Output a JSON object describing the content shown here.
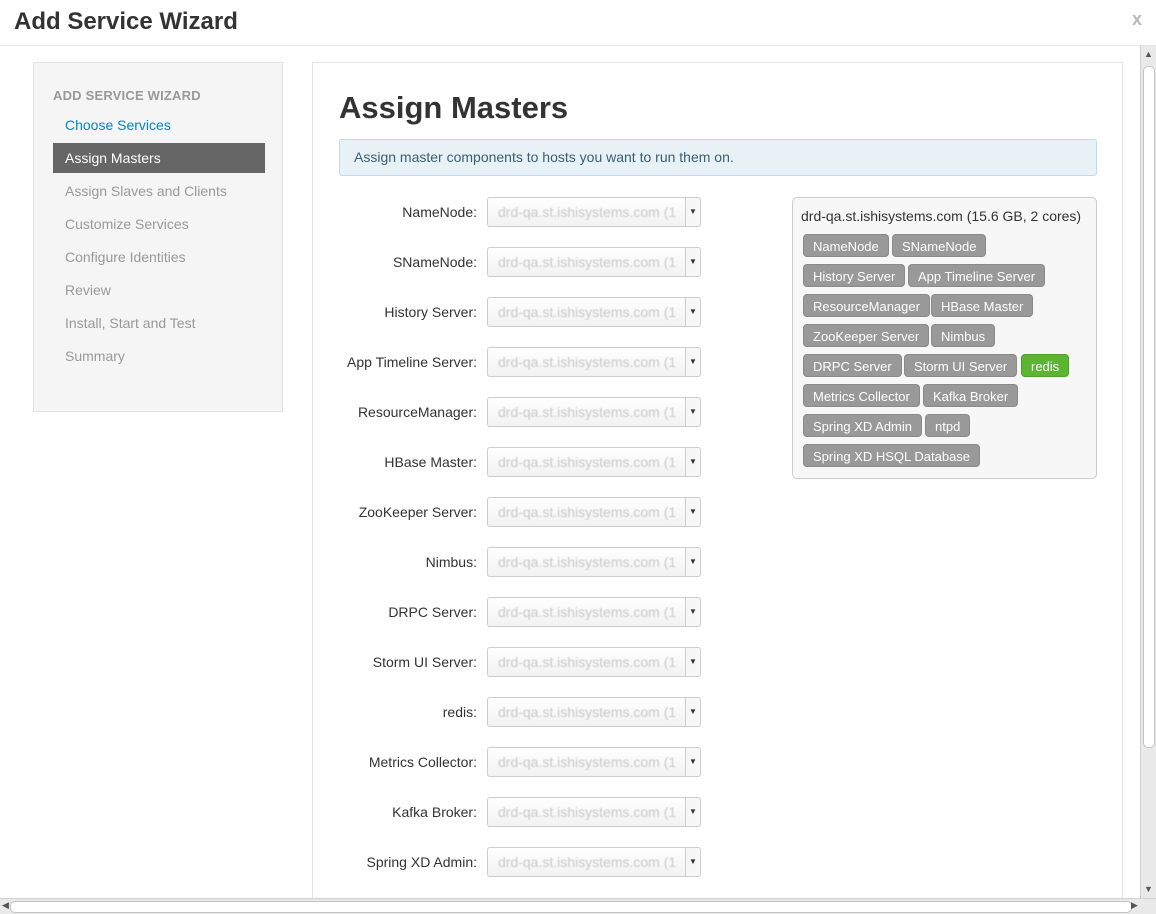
{
  "window": {
    "title": "Add Service Wizard",
    "close": "x"
  },
  "nav": {
    "header": "ADD SERVICE WIZARD",
    "items": [
      {
        "label": "Choose Services"
      },
      {
        "label": "Assign Masters"
      },
      {
        "label": "Assign Slaves and Clients"
      },
      {
        "label": "Customize Services"
      },
      {
        "label": "Configure Identities"
      },
      {
        "label": "Review"
      },
      {
        "label": "Install, Start and Test"
      },
      {
        "label": "Summary"
      }
    ]
  },
  "main": {
    "title": "Assign Masters",
    "info": "Assign master components to hosts you want to run them on.",
    "rows": [
      {
        "label": "NameNode:",
        "value": "drd-qa.st.ishisystems.com (1"
      },
      {
        "label": "SNameNode:",
        "value": "drd-qa.st.ishisystems.com (1"
      },
      {
        "label": "History Server:",
        "value": "drd-qa.st.ishisystems.com (1"
      },
      {
        "label": "App Timeline Server:",
        "value": "drd-qa.st.ishisystems.com (1"
      },
      {
        "label": "ResourceManager:",
        "value": "drd-qa.st.ishisystems.com (1"
      },
      {
        "label": "HBase Master:",
        "value": "drd-qa.st.ishisystems.com (1"
      },
      {
        "label": "ZooKeeper Server:",
        "value": "drd-qa.st.ishisystems.com (1"
      },
      {
        "label": "Nimbus:",
        "value": "drd-qa.st.ishisystems.com (1"
      },
      {
        "label": "DRPC Server:",
        "value": "drd-qa.st.ishisystems.com (1"
      },
      {
        "label": "Storm UI Server:",
        "value": "drd-qa.st.ishisystems.com (1"
      },
      {
        "label": "redis:",
        "value": "drd-qa.st.ishisystems.com (1"
      },
      {
        "label": "Metrics Collector:",
        "value": "drd-qa.st.ishisystems.com (1"
      },
      {
        "label": "Kafka Broker:",
        "value": "drd-qa.st.ishisystems.com (1"
      },
      {
        "label": "Spring XD Admin:",
        "value": "drd-qa.st.ishisystems.com (1"
      }
    ],
    "host": {
      "title": "drd-qa.st.ishisystems.com (15.6 GB, 2 cores)",
      "components": [
        {
          "label": "NameNode"
        },
        {
          "label": "SNameNode"
        },
        {
          "label": "History Server"
        },
        {
          "label": "App Timeline Server"
        },
        {
          "label": "ResourceManager"
        },
        {
          "label": "HBase Master"
        },
        {
          "label": "ZooKeeper Server"
        },
        {
          "label": "Nimbus"
        },
        {
          "label": "DRPC Server"
        },
        {
          "label": "Storm UI Server"
        },
        {
          "label": "redis"
        },
        {
          "label": "Metrics Collector"
        },
        {
          "label": "Kafka Broker"
        },
        {
          "label": "Spring XD Admin"
        },
        {
          "label": "ntpd"
        },
        {
          "label": "Spring XD HSQL Database"
        }
      ]
    }
  },
  "colors": {
    "active_nav": "#666666",
    "link": "#0088cc",
    "chip": "#999999",
    "chip_new": "#5bb531"
  },
  "icons": {
    "select_arrow": "caret-down-icon",
    "close": "close-icon"
  }
}
